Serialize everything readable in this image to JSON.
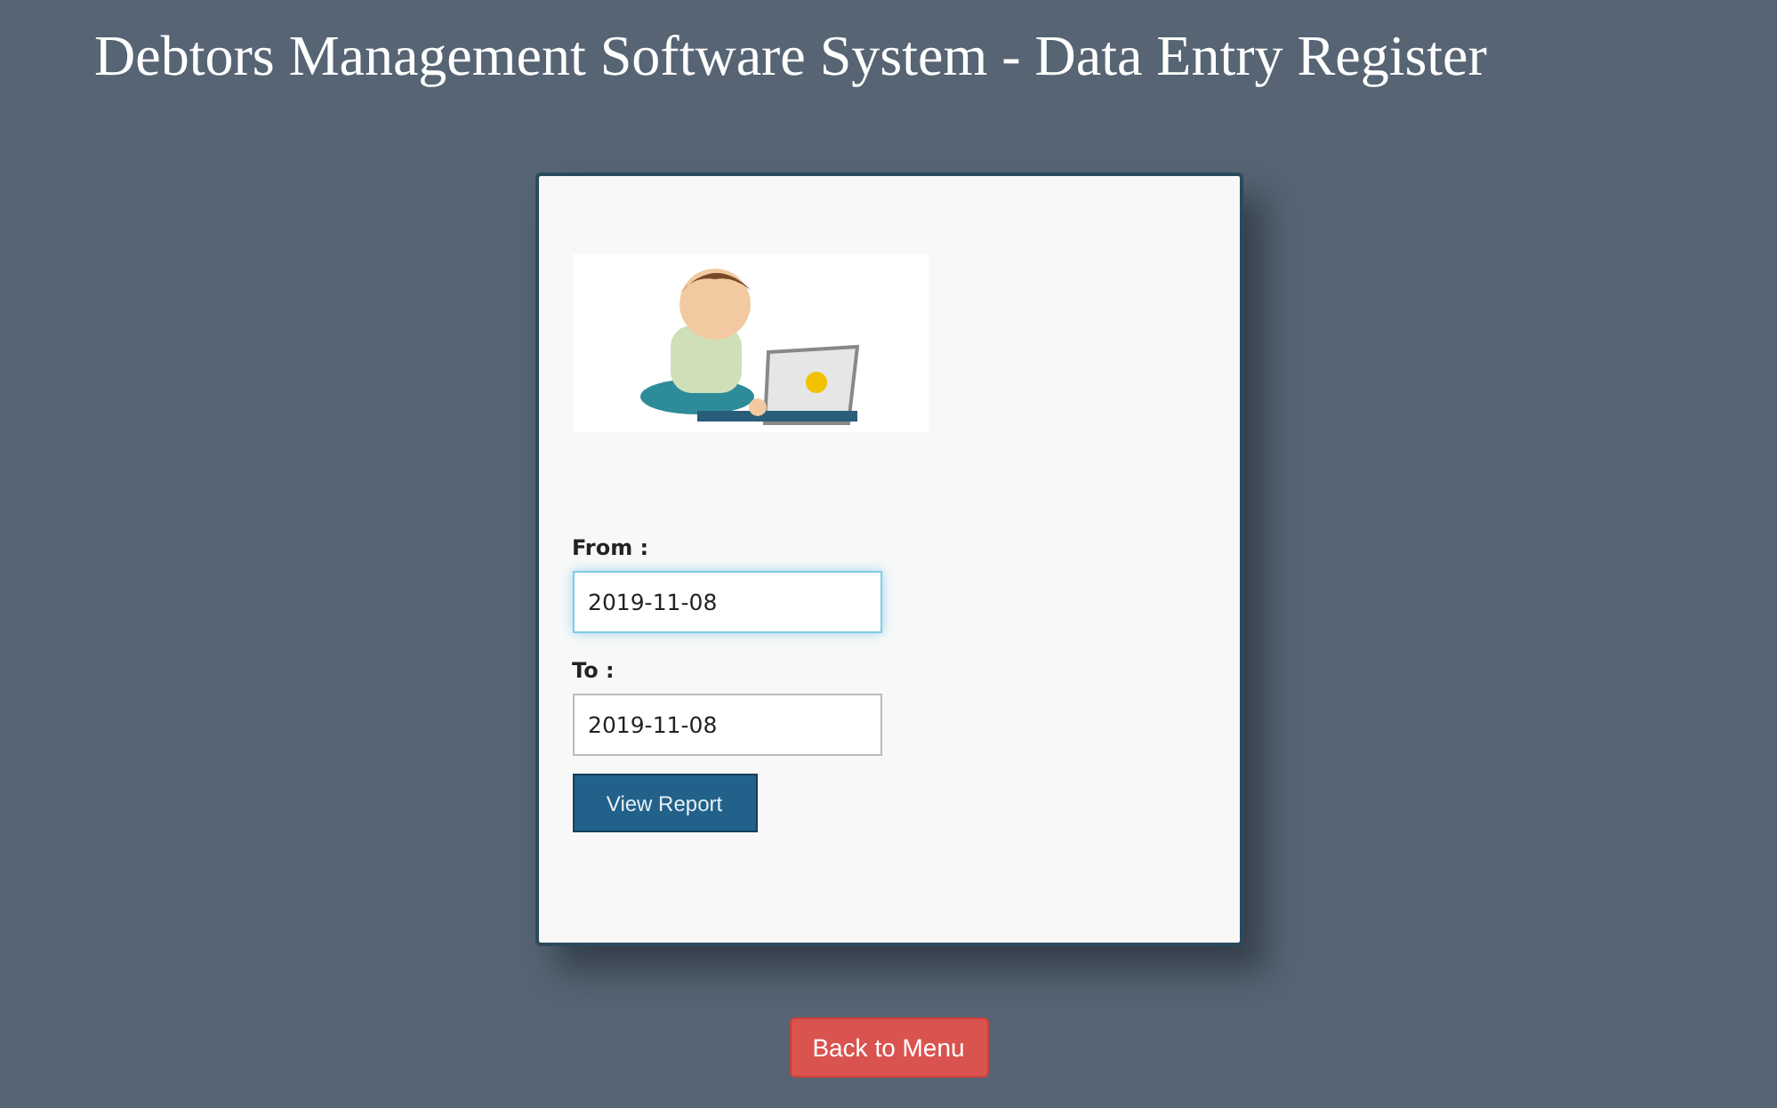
{
  "title": "Debtors Management Software System - Data Entry Register",
  "card": {
    "fields": [
      {
        "label": "From :",
        "value": "2019-11-08",
        "focused": true
      },
      {
        "label": "To :",
        "value": "2019-11-08",
        "focused": false
      }
    ],
    "submit": "View Report"
  },
  "back_button": "Back to Menu"
}
